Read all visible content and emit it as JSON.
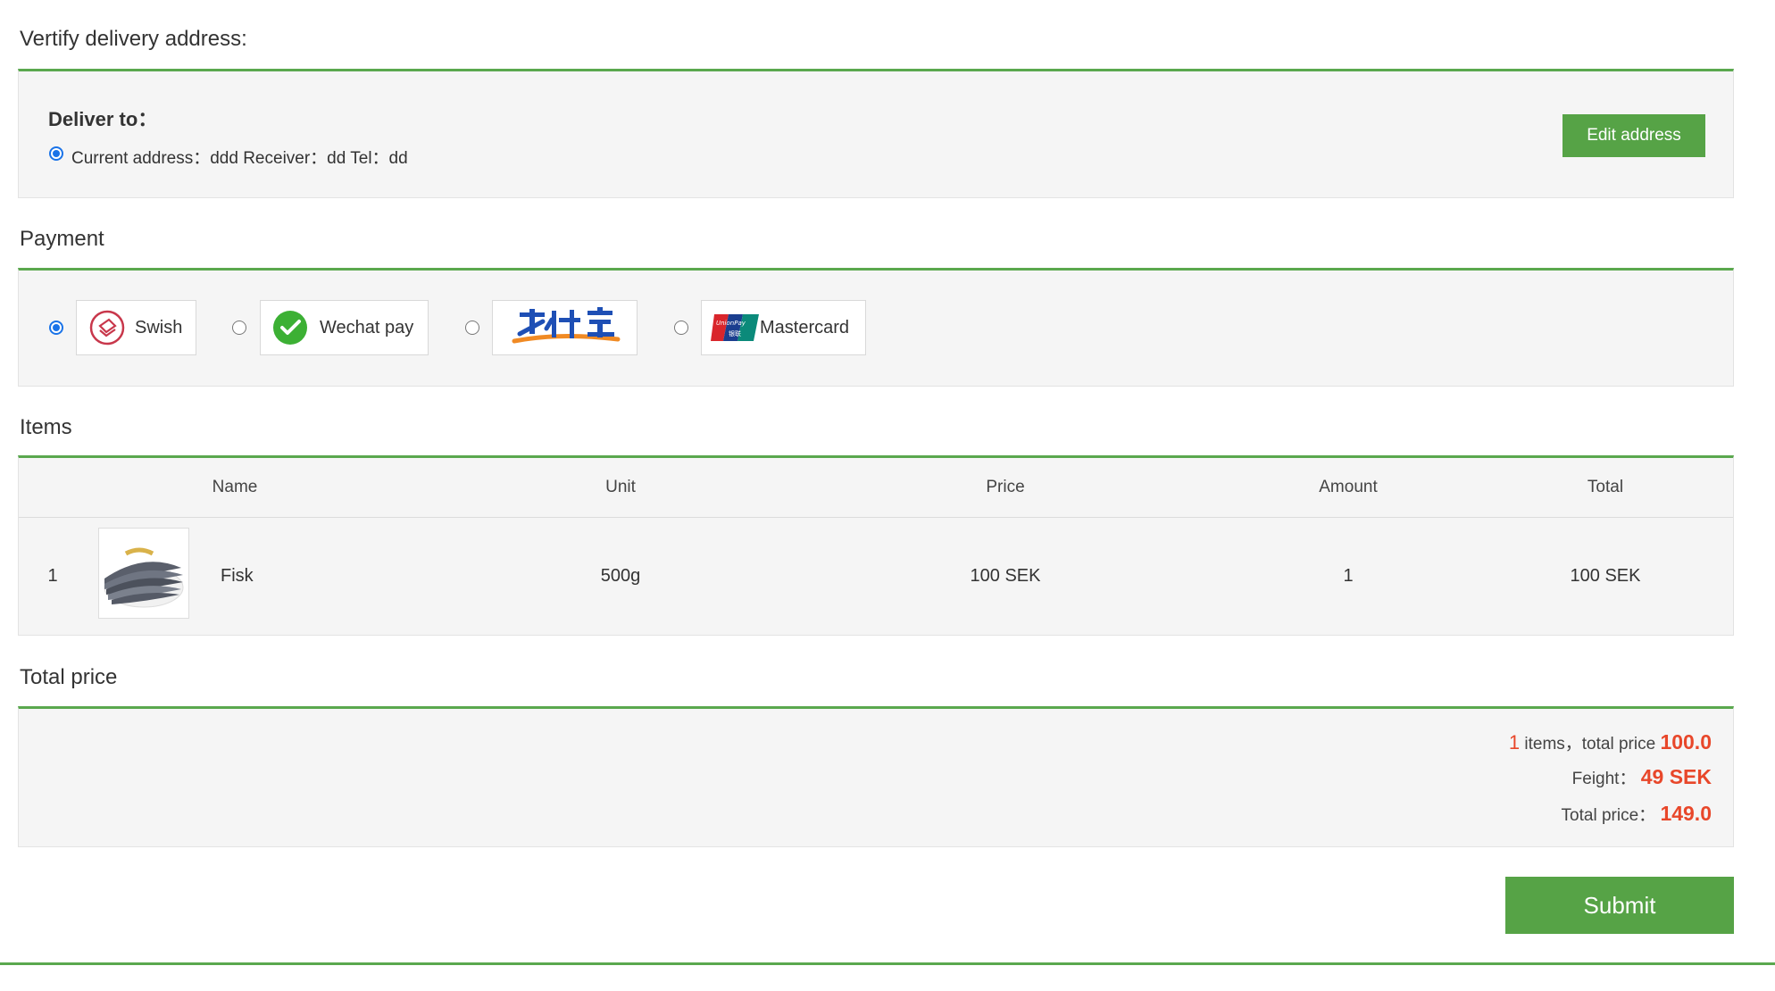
{
  "delivery": {
    "section_title": "Vertify delivery address:",
    "deliver_to_label": "Deliver to：",
    "address_line": "Current address：ddd Receiver：dd Tel：dd",
    "edit_button_label": "Edit address"
  },
  "payment": {
    "section_title": "Payment",
    "options": [
      {
        "label": "Swish",
        "selected": true,
        "icon": "swish-icon"
      },
      {
        "label": "Wechat pay",
        "selected": false,
        "icon": "wechat-icon"
      },
      {
        "label": "",
        "selected": false,
        "icon": "alipay-logo"
      },
      {
        "label": "Mastercard",
        "selected": false,
        "icon": "unionpay-icon"
      }
    ]
  },
  "items": {
    "section_title": "Items",
    "columns": [
      "Name",
      "Unit",
      "Price",
      "Amount",
      "Total"
    ],
    "rows": [
      {
        "index": "1",
        "image": "fish-thumbnail",
        "name": "Fisk",
        "unit": "500g",
        "price": "100 SEK",
        "amount": "1",
        "total": "100 SEK"
      }
    ]
  },
  "total": {
    "section_title": "Total price",
    "item_count": "1",
    "items_text": "items，total price",
    "items_total": "100.0",
    "freight_label": "Feight：",
    "freight_value": "49 SEK",
    "total_label": "Total price：",
    "total_value": "149.0"
  },
  "submit_label": "Submit",
  "colors": {
    "accent_green": "#56a346",
    "highlight_orange": "#e8472a",
    "radio_blue": "#1a73e8",
    "panel_bg": "#f5f5f5"
  }
}
